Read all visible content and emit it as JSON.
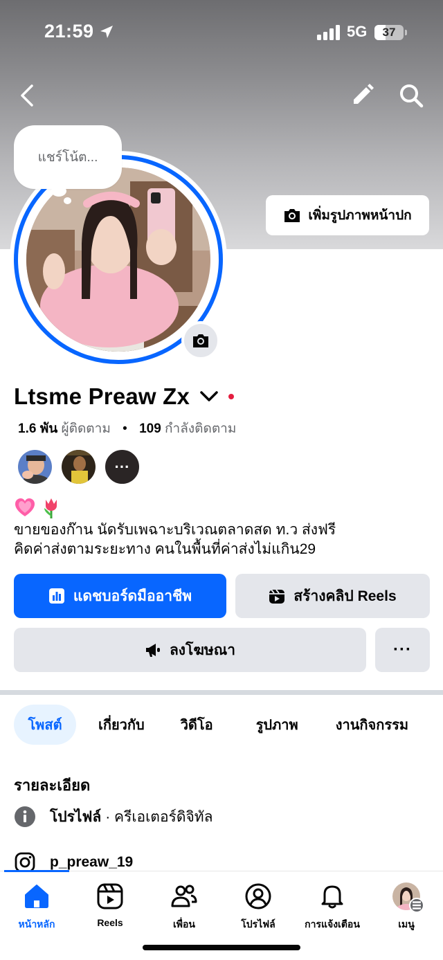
{
  "status_bar": {
    "time": "21:59",
    "network": "5G",
    "battery": "37",
    "battery_level": 0.37
  },
  "header": {
    "back_icon": "chevron-left-icon",
    "edit_icon": "pencil-icon",
    "search_icon": "search-icon"
  },
  "cover": {
    "add_cover_label": "เพิ่มรูปภาพหน้าปก"
  },
  "note": {
    "placeholder": "แชร์โน้ต..."
  },
  "profile": {
    "name": "Ltsme Preaw Zx",
    "followers_count": "1.6 พัน",
    "followers_label": "ผู้ติดตาม",
    "following_count": "109",
    "following_label": "กำลังติดตาม",
    "friends_more": "···",
    "bio_line1": "ขายของก๊าน นัดรับเพฉาะบริเวณตลาดสด ท.ว ส่งฟรี",
    "bio_line2": "คิดค่าส่งตามระยะทาง  คนในพื้นที่ค่าส่งไม่แกิน29"
  },
  "actions": {
    "dashboard_label": "แดชบอร์ดมืออาชีพ",
    "reels_label": "สร้างคลิป Reels",
    "ads_label": "ลงโฆษณา",
    "more_label": "···"
  },
  "tabs": [
    {
      "label": "โพสต์",
      "active": true
    },
    {
      "label": "เกี่ยวกับ",
      "active": false
    },
    {
      "label": "วิดีโอ",
      "active": false
    },
    {
      "label": "รูปภาพ",
      "active": false
    },
    {
      "label": "งานกิจกรรม",
      "active": false
    }
  ],
  "details": {
    "title": "รายละเอียด",
    "profile_type": "โปรไฟล์",
    "profile_category": "· ครีเอเตอร์ดิจิทัล",
    "instagram": "p_preaw_19"
  },
  "bottom_nav": [
    {
      "label": "หน้าหลัก",
      "icon": "home-icon",
      "active": true
    },
    {
      "label": "Reels",
      "icon": "reels-icon",
      "active": false
    },
    {
      "label": "เพื่อน",
      "icon": "friends-icon",
      "active": false
    },
    {
      "label": "โปรไฟล์",
      "icon": "profile-icon",
      "active": false
    },
    {
      "label": "การแจ้งเตือน",
      "icon": "bell-icon",
      "active": false
    },
    {
      "label": "เมนู",
      "icon": "menu-avatar",
      "active": false
    }
  ],
  "colors": {
    "accent": "#0866ff",
    "secondary_button": "#e4e6eb",
    "active_tab_bg": "#e7f3ff",
    "status_dot": "#e41e3f"
  }
}
